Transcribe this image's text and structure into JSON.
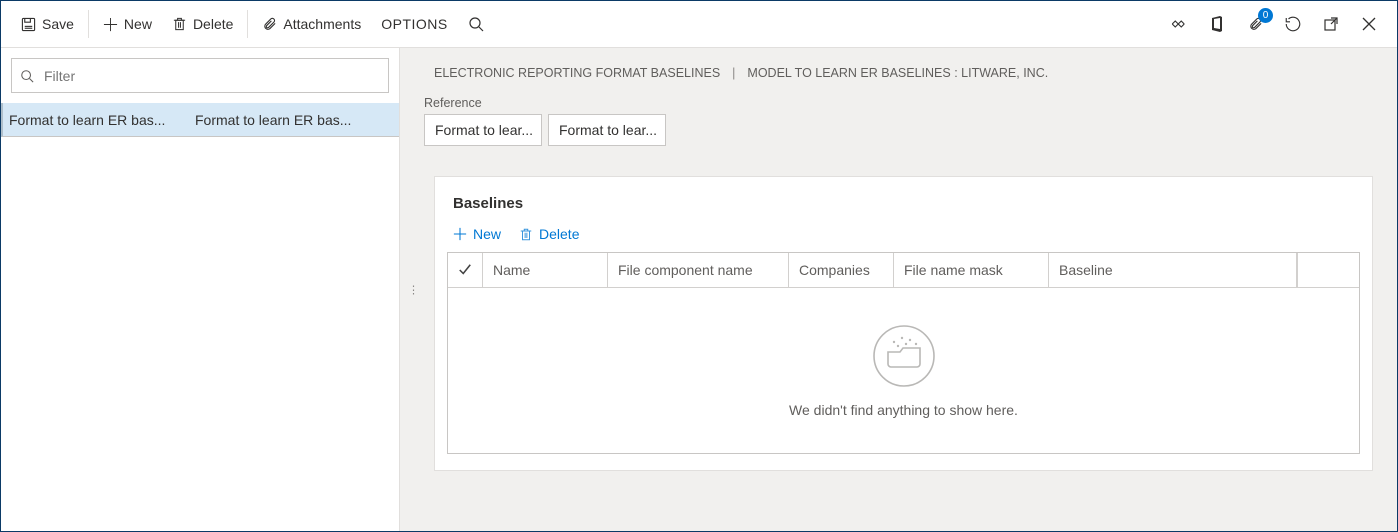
{
  "appbar": {
    "save": "Save",
    "new": "New",
    "delete": "Delete",
    "attachments": "Attachments",
    "options": "OPTIONS",
    "badge_count": "0"
  },
  "filter": {
    "placeholder": "Filter"
  },
  "left_list": {
    "row": {
      "col1": "Format to learn ER bas...",
      "col2": "Format to learn ER bas..."
    }
  },
  "crumbs": {
    "a": "ELECTRONIC REPORTING FORMAT BASELINES",
    "sep": "|",
    "b": "MODEL TO LEARN ER BASELINES : LITWARE, INC."
  },
  "reference": {
    "label": "Reference",
    "val1": "Format to lear...",
    "val2": "Format to lear..."
  },
  "card": {
    "title": "Baselines",
    "actions": {
      "new": "New",
      "delete": "Delete"
    },
    "columns": {
      "name": "Name",
      "file_component": "File component name",
      "companies": "Companies",
      "mask": "File name mask",
      "baseline": "Baseline"
    },
    "empty": "We didn't find anything to show here."
  }
}
